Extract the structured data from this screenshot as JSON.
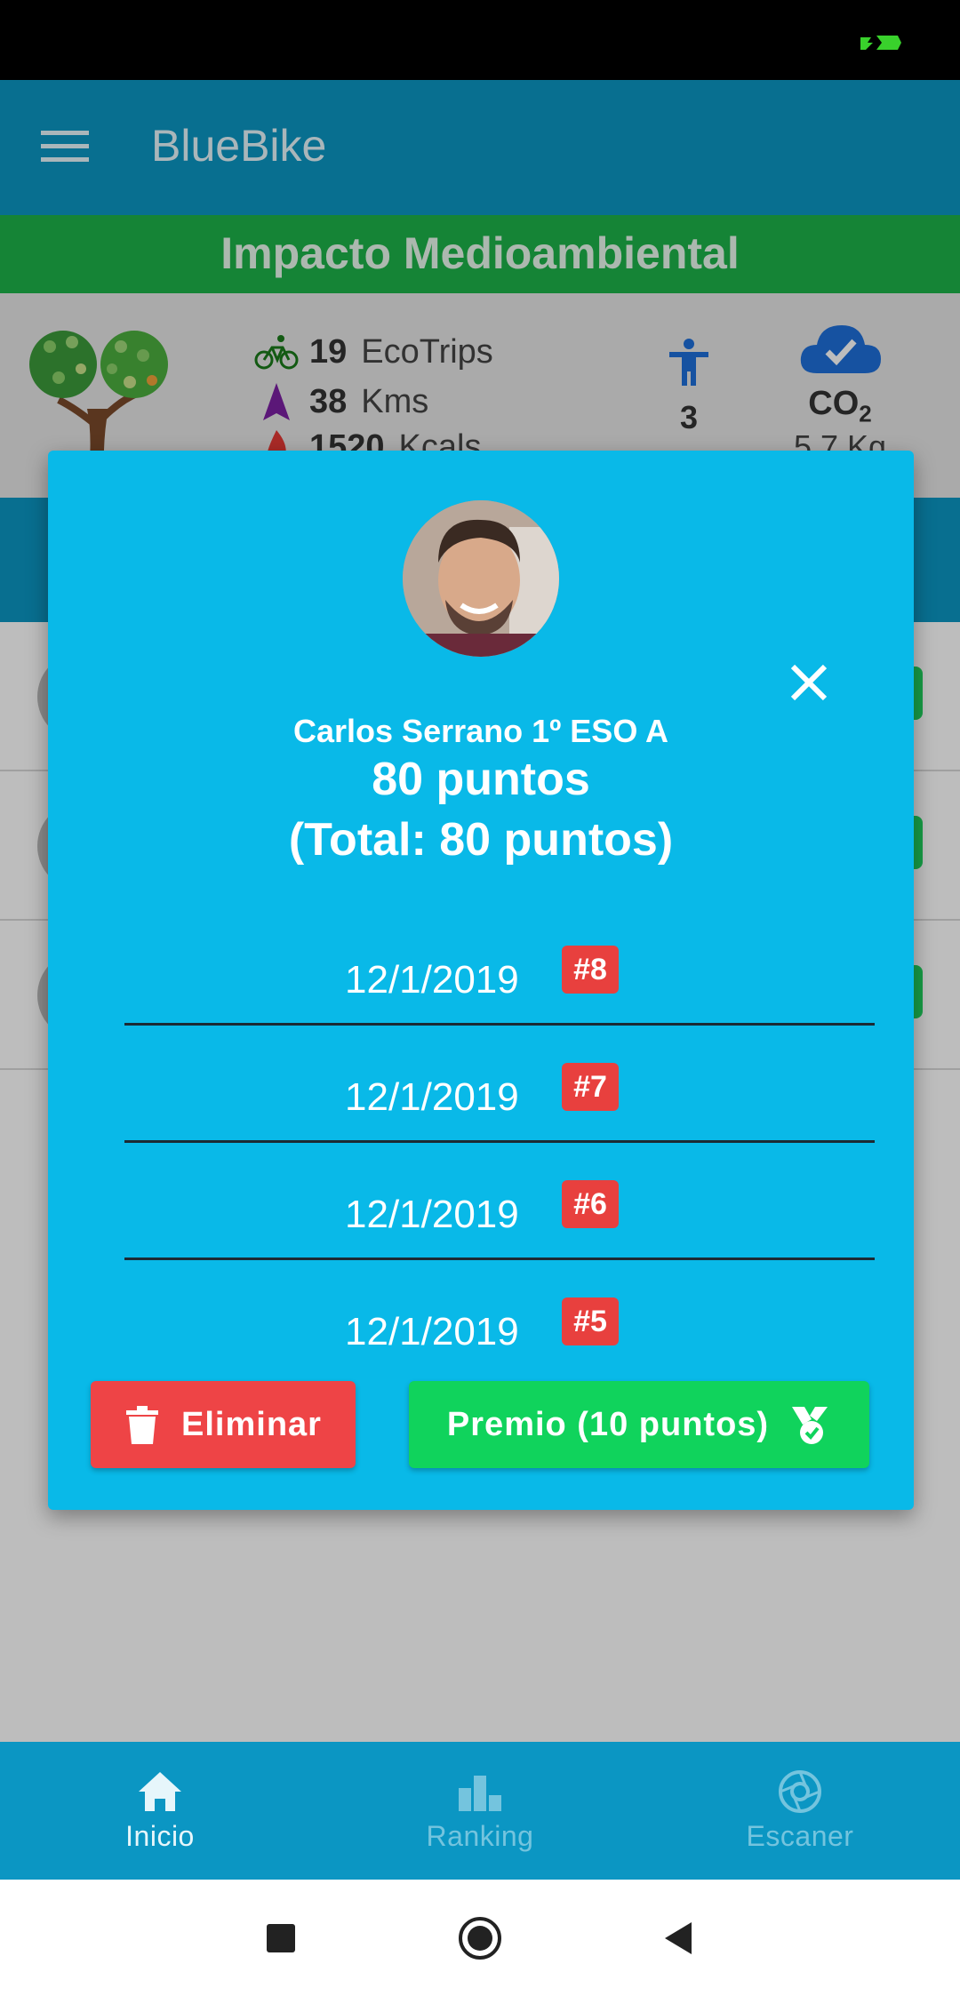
{
  "app": {
    "title": "BlueBike"
  },
  "impact": {
    "title": "Impacto Medioambiental",
    "ecotrips_value": "19",
    "ecotrips_label": "EcoTrips",
    "kms_value": "38",
    "kms_label": "Kms",
    "kcals_value": "1520",
    "kcals_label": "Kcals",
    "people_value": "3",
    "co2_label": "CO",
    "co2_sub": "2",
    "co2_value": "5.7 Kg"
  },
  "dialog": {
    "student_name": "Carlos Serrano 1º ESO A",
    "points": "80 puntos",
    "total_points": "(Total: 80 puntos)",
    "trips": [
      {
        "date": "12/1/2019",
        "badge": "#8"
      },
      {
        "date": "12/1/2019",
        "badge": "#7"
      },
      {
        "date": "12/1/2019",
        "badge": "#6"
      },
      {
        "date": "12/1/2019",
        "badge": "#5"
      }
    ],
    "delete_label": "Eliminar",
    "prize_label": "Premio (10 puntos)"
  },
  "bottom_nav": {
    "items": [
      {
        "label": "Inicio",
        "icon": "home-icon",
        "active": true
      },
      {
        "label": "Ranking",
        "icon": "ranking-icon",
        "active": false
      },
      {
        "label": "Escaner",
        "icon": "camera-shutter-icon",
        "active": false
      }
    ]
  },
  "colors": {
    "primary": "#0b96c3",
    "dialog": "#09b9e8",
    "impact_green": "#1db34a",
    "delete_red": "#ee4446",
    "prize_green": "#10d35c",
    "badge_red": "#e8403e"
  }
}
